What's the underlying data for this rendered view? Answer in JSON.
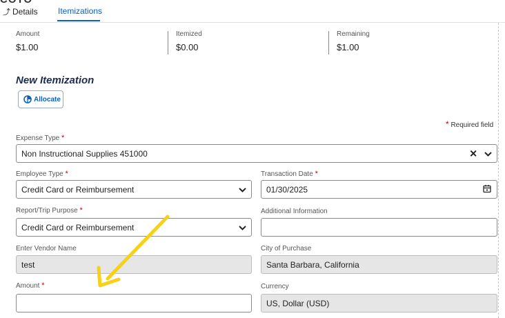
{
  "tabs": [
    {
      "label": "Details",
      "active": false
    },
    {
      "label": "Itemizations",
      "active": true
    }
  ],
  "summary": {
    "amount_label": "Amount",
    "amount_value": "$1.00",
    "itemized_label": "Itemized",
    "itemized_value": "$0.00",
    "remaining_label": "Remaining",
    "remaining_value": "$1.00"
  },
  "section_title": "New Itemization",
  "allocate_button": "Allocate",
  "required_note": "Required field",
  "required_mark": "*",
  "fields": {
    "expense_type": {
      "label": "Expense Type",
      "value": "Non Instructional Supplies 451000"
    },
    "employee_type": {
      "label": "Employee Type",
      "value": "Credit Card or Reimbursement"
    },
    "transaction_date": {
      "label": "Transaction Date",
      "value": "01/30/2025"
    },
    "purpose": {
      "label": "Report/Trip Purpose",
      "value": "Credit Card or Reimbursement"
    },
    "additional_info": {
      "label": "Additional Information",
      "value": ""
    },
    "vendor_name": {
      "label": "Enter Vendor Name",
      "value": "test"
    },
    "city": {
      "label": "City of Purchase",
      "value": "Santa Barbara, California"
    },
    "amount": {
      "label": "Amount",
      "value": ""
    },
    "currency": {
      "label": "Currency",
      "value": "US, Dollar (USD)"
    }
  },
  "colors": {
    "accent": "#0a5fc4",
    "required": "#cc0000",
    "annotation_arrow": "#f5d11a"
  },
  "icons": [
    "back-arrow-icon",
    "allocate-icon",
    "clear-icon",
    "chevron-down-icon",
    "calendar-icon"
  ]
}
